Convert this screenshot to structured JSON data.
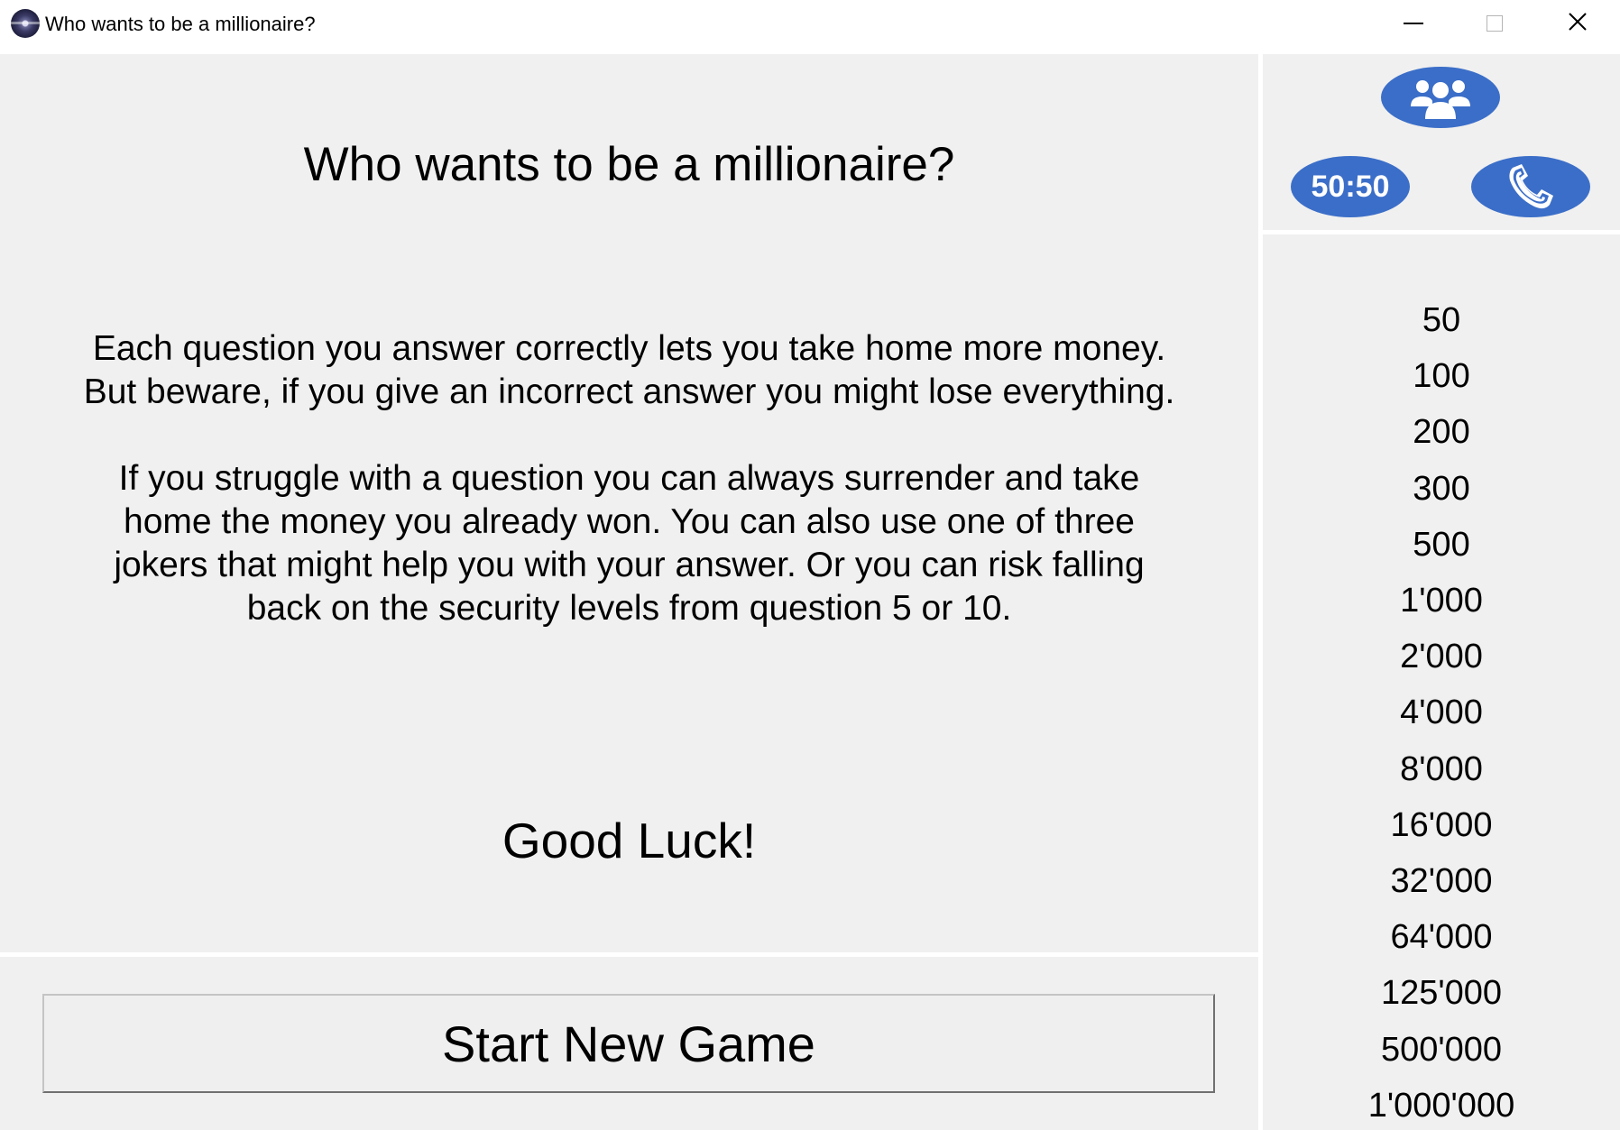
{
  "window": {
    "title": "Who wants to be a millionaire?"
  },
  "main": {
    "title": "Who wants to be a millionaire?",
    "rules": [
      "Each question you answer correctly lets you take home more money. But beware, if you give an incorrect answer you might lose everything.",
      "If you struggle with a question you can always surrender and take home the money you already won. You can also use one of three jokers that might help you with your answer. Or you can risk falling back on the security levels from question 5 or 10."
    ],
    "good_luck": "Good Luck!",
    "start_button_label": "Start New Game"
  },
  "lifelines": {
    "fifty_fifty_label": "50:50",
    "color": "#3b6ec8",
    "icons": [
      "audience-icon",
      "fifty-fifty-icon",
      "phone-icon"
    ]
  },
  "prize_ladder": [
    "50",
    "100",
    "200",
    "300",
    "500",
    "1'000",
    "2'000",
    "4'000",
    "8'000",
    "16'000",
    "32'000",
    "64'000",
    "125'000",
    "500'000",
    "1'000'000"
  ]
}
